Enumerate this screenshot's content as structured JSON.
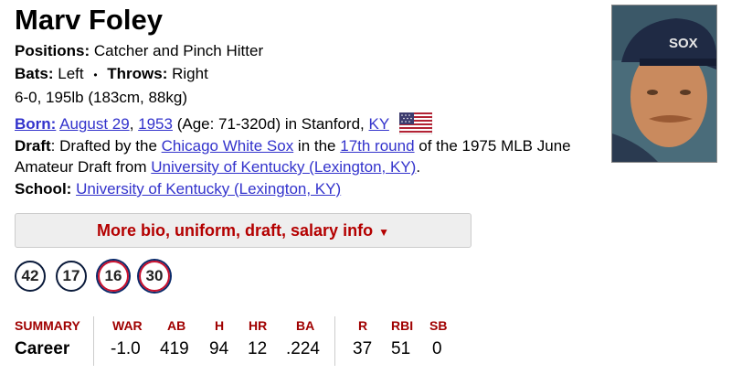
{
  "player": {
    "name": "Marv Foley",
    "positions_label": "Positions:",
    "positions": "Catcher and Pinch Hitter",
    "bats_label": "Bats:",
    "bats": "Left",
    "sep": "•",
    "throws_label": "Throws:",
    "throws": "Right",
    "size": "6-0, 195lb (183cm, 88kg)",
    "born_label": "Born:",
    "born_date": "August 29",
    "born_year": "1953",
    "born_age": "(Age: 71-320d) in Stanford,",
    "born_state": "KY",
    "draft_label": "Draft",
    "draft_text1": ": Drafted by the ",
    "draft_team": "Chicago White Sox",
    "draft_text2": " in the ",
    "draft_round": "17th round",
    "draft_text3": " of the 1975 MLB June",
    "draft_text4": "Amateur Draft from ",
    "draft_school": "University of Kentucky (Lexington, KY)",
    "draft_text5": ".",
    "school_label": "School:",
    "school": "University of Kentucky (Lexington, KY)"
  },
  "more_button": {
    "label": "More bio, uniform, draft, salary info",
    "arrow": "▼"
  },
  "uniform_numbers": [
    "42",
    "17",
    "16",
    "30"
  ],
  "stats": {
    "summary_label": "SUMMARY",
    "row_label": "Career",
    "headers": [
      "WAR",
      "AB",
      "H",
      "HR",
      "BA",
      "R",
      "RBI",
      "SB"
    ],
    "values": [
      "-1.0",
      "419",
      "94",
      "12",
      ".224",
      "37",
      "51",
      "0"
    ]
  },
  "colors": {
    "link": "#3333cc",
    "accent": "#b40000",
    "stat_header": "#a00000"
  }
}
